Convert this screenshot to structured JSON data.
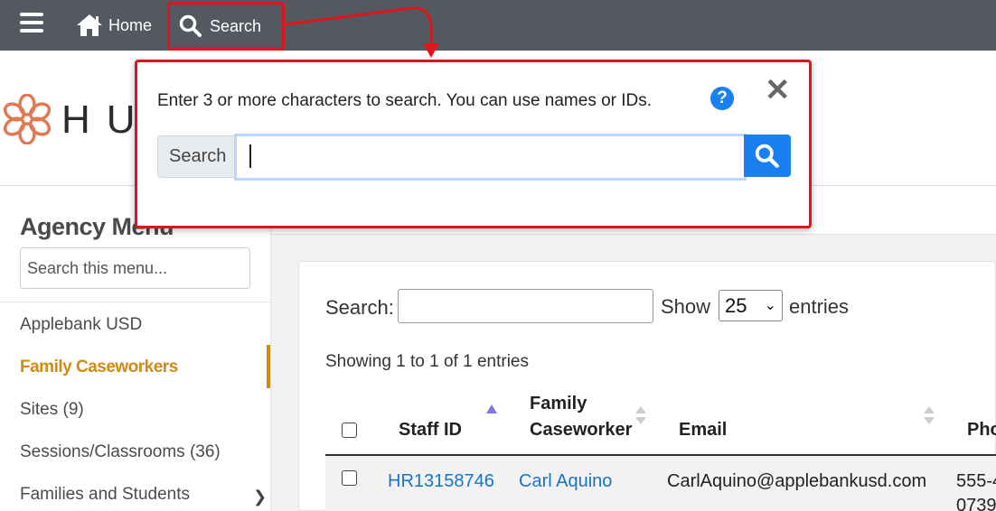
{
  "nav": {
    "home_label": "Home",
    "search_label": "Search",
    "icons": [
      "hamburger-icon",
      "home-icon",
      "search-icon"
    ]
  },
  "logo": {
    "text": "HU"
  },
  "sidebar": {
    "title": "Agency Menu",
    "search_placeholder": "Search this menu...",
    "items": [
      {
        "label": "Applebank USD",
        "active": false
      },
      {
        "label": "Family Caseworkers",
        "active": true
      },
      {
        "label": "Sites (9)",
        "active": false
      },
      {
        "label": "Sessions/Classrooms (36)",
        "active": false
      },
      {
        "label": "Families and Students",
        "active": false,
        "has_submenu": true
      }
    ],
    "active_color": "#d18a14"
  },
  "table_controls": {
    "search_label": "Search:",
    "show_label": "Show",
    "page_length": "25",
    "entries_label": "entries",
    "info": "Showing 1 to 1 of 1 entries"
  },
  "table": {
    "headers": {
      "staff_id": "Staff ID",
      "caseworker_1": "Family",
      "caseworker_2": "Caseworker",
      "email": "Email",
      "phone": "Pho"
    },
    "rows": [
      {
        "staff_id": "HR13158746",
        "caseworker": "Carl Aquino",
        "email": "CarlAquino@applebankusd.com",
        "phone_1": "555-4",
        "phone_2": "0739"
      }
    ]
  },
  "popup": {
    "message": "Enter 3 or more characters to search. You can use names or IDs.",
    "help_label": "?",
    "addon_label": "Search",
    "input_value": "",
    "highlight_color": "#e0141b",
    "button_color": "#1a7ff0"
  }
}
